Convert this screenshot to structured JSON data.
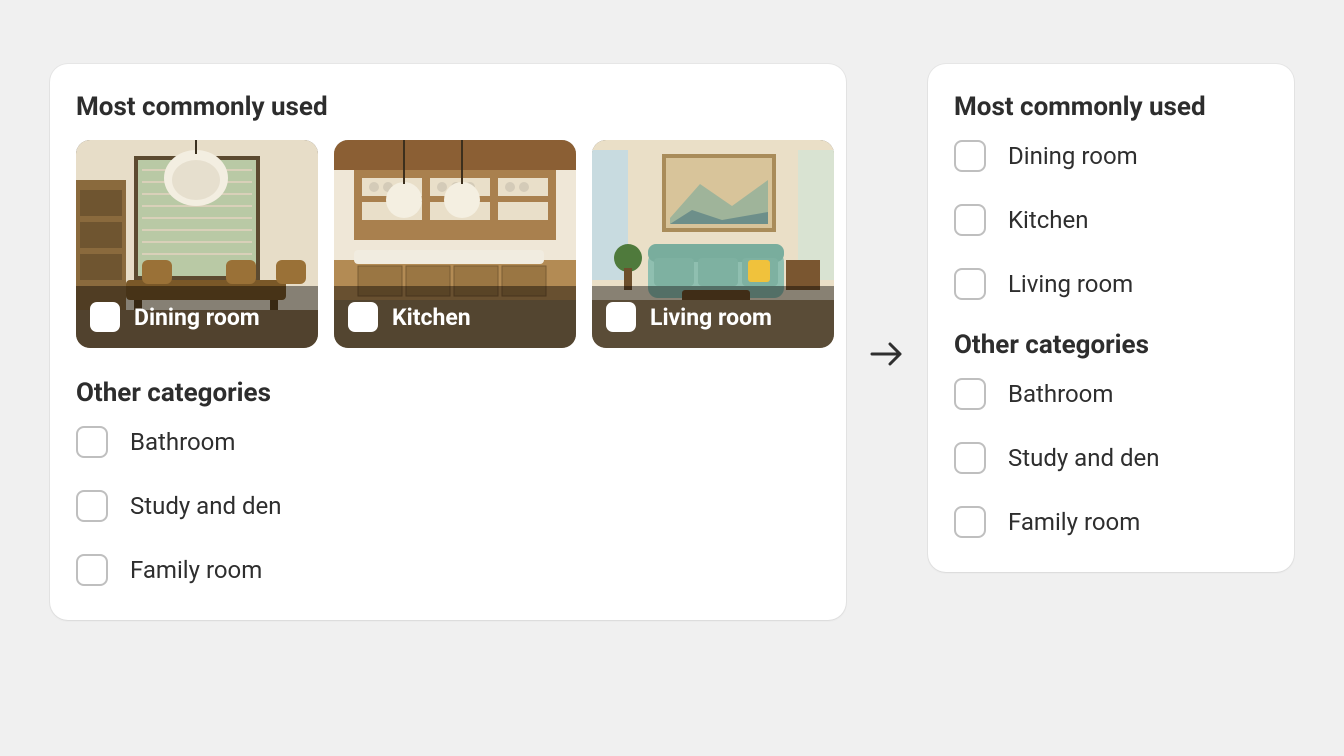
{
  "left": {
    "section1_title": "Most commonly used",
    "thumbs": [
      {
        "label": "Dining room"
      },
      {
        "label": "Kitchen"
      },
      {
        "label": "Living room"
      }
    ],
    "section2_title": "Other categories",
    "others": [
      {
        "label": "Bathroom"
      },
      {
        "label": "Study and den"
      },
      {
        "label": "Family room"
      }
    ]
  },
  "right": {
    "section1_title": "Most commonly used",
    "common": [
      {
        "label": "Dining room"
      },
      {
        "label": "Kitchen"
      },
      {
        "label": "Living room"
      }
    ],
    "section2_title": "Other categories",
    "others": [
      {
        "label": "Bathroom"
      },
      {
        "label": "Study and den"
      },
      {
        "label": "Family room"
      }
    ]
  }
}
